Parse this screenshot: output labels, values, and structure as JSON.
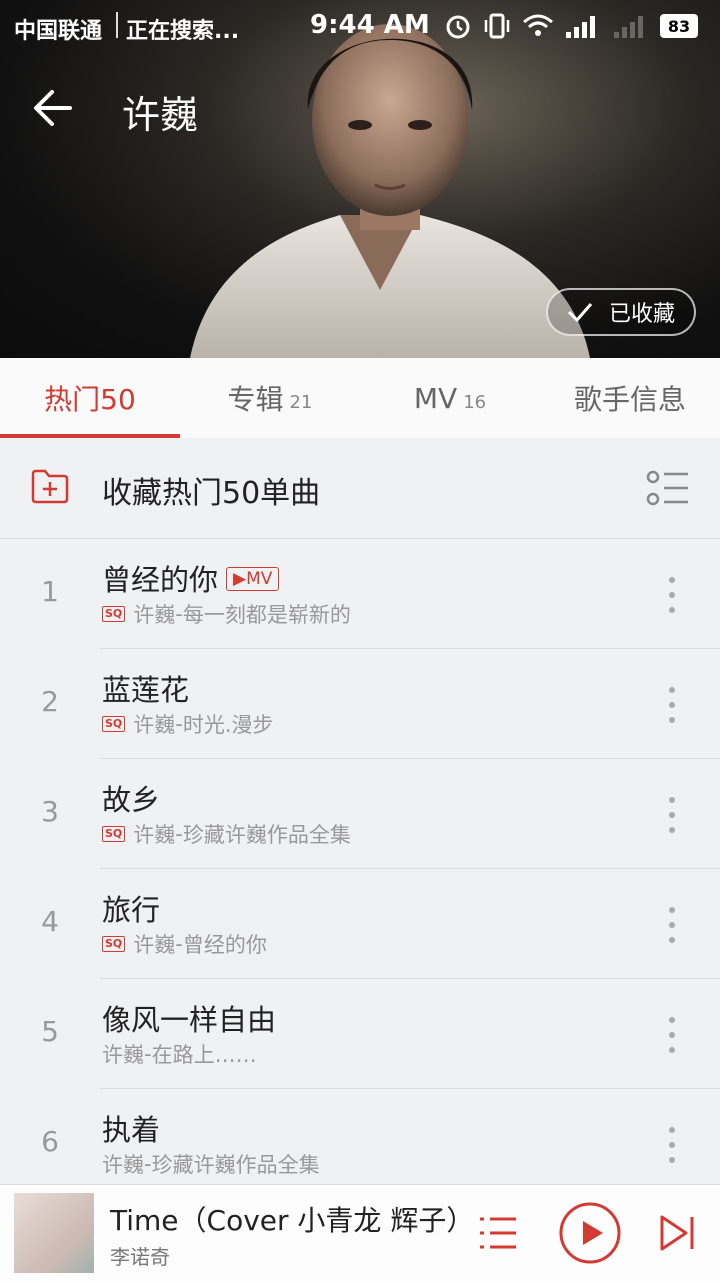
{
  "status_bar": {
    "carrier": "中国联通",
    "app_status": "正在搜索...",
    "time": "9:44 AM",
    "battery": "83",
    "icons": [
      "alarm-icon",
      "vibrate-icon",
      "wifi-icon",
      "signal-icon",
      "signal-icon-2",
      "battery-icon"
    ]
  },
  "header": {
    "title": "许巍",
    "collected_label": "已收藏"
  },
  "tabs": [
    {
      "label": "热门50",
      "count": ""
    },
    {
      "label": "专辑",
      "count": "21"
    },
    {
      "label": "MV",
      "count": "16"
    },
    {
      "label": "歌手信息",
      "count": ""
    }
  ],
  "collect_row": {
    "label": "收藏热门50单曲"
  },
  "songs": [
    {
      "num": "1",
      "title": "曾经的你",
      "mv": "▶MV",
      "sq": "SQ",
      "artist": "许巍",
      "album": "每一刻都是崭新的"
    },
    {
      "num": "2",
      "title": "蓝莲花",
      "sq": "SQ",
      "artist": "许巍",
      "album": "时光.漫步"
    },
    {
      "num": "3",
      "title": "故乡",
      "sq": "SQ",
      "artist": "许巍",
      "album": "珍藏许巍作品全集"
    },
    {
      "num": "4",
      "title": "旅行",
      "sq": "SQ",
      "artist": "许巍",
      "album": "曾经的你"
    },
    {
      "num": "5",
      "title": "像风一样自由",
      "artist": "许巍",
      "album": "在路上……"
    },
    {
      "num": "6",
      "title": "执着",
      "artist": "许巍",
      "album": "珍藏许巍作品全集"
    }
  ],
  "separator": " - ",
  "player": {
    "title": "Time（Cover 小青龙 辉子）",
    "artist": "李诺奇"
  },
  "colors": {
    "accent": "#d33a31"
  }
}
